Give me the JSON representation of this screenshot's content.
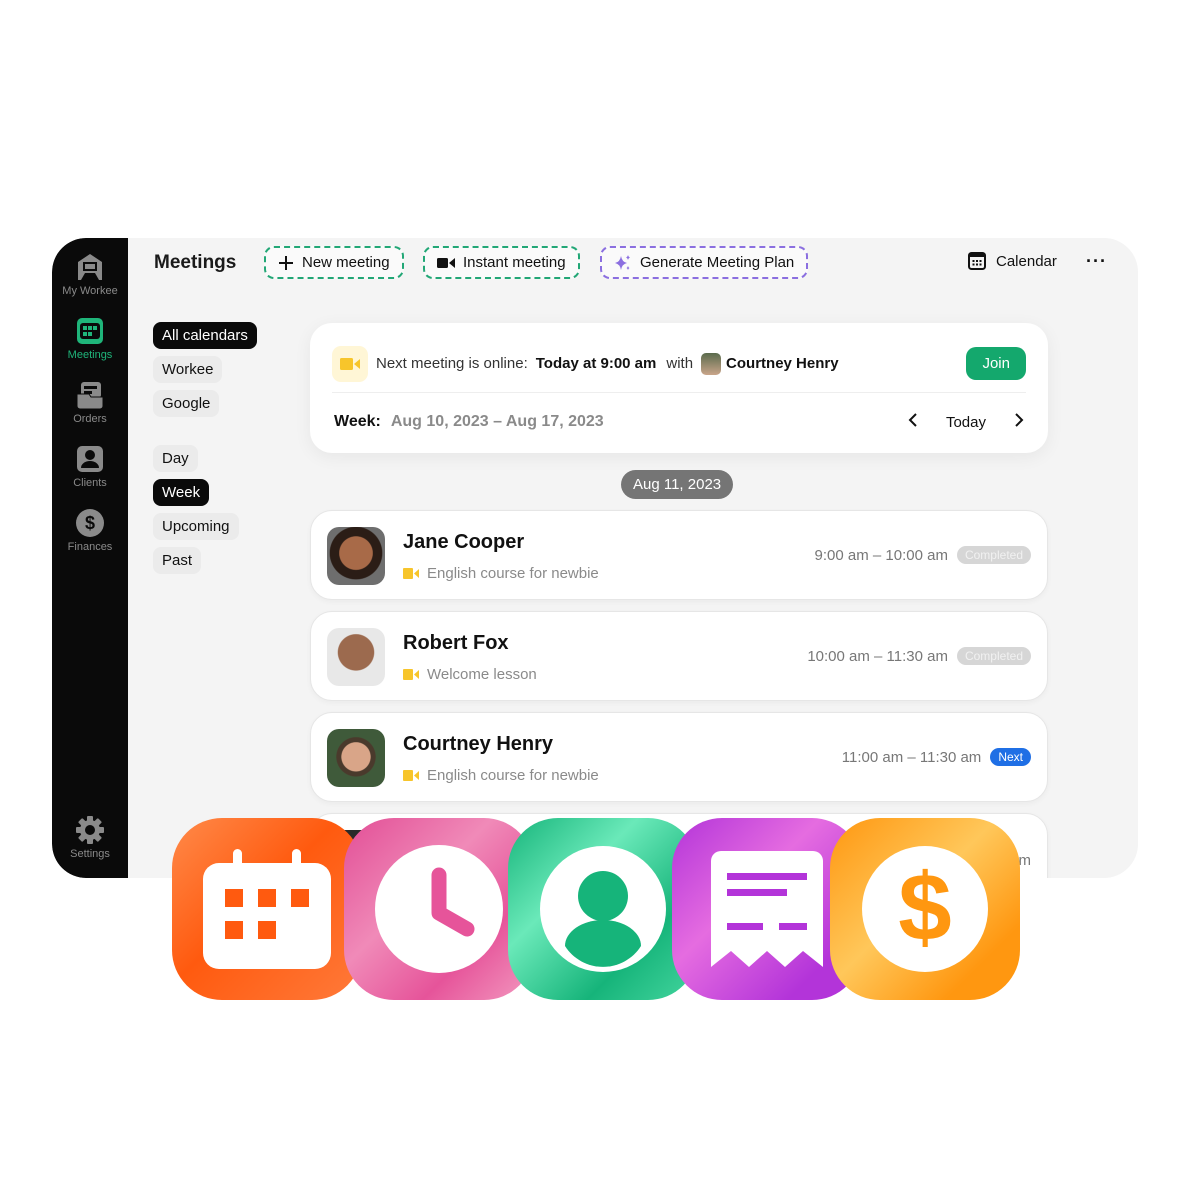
{
  "sidebar": {
    "items": [
      {
        "label": "My Workee",
        "icon": "workee-logo-icon"
      },
      {
        "label": "Meetings",
        "icon": "calendar-grid-icon",
        "active": true
      },
      {
        "label": "Orders",
        "icon": "orders-icon"
      },
      {
        "label": "Clients",
        "icon": "client-icon"
      },
      {
        "label": "Finances",
        "icon": "dollar-icon"
      },
      {
        "label": "Settings",
        "icon": "gear-icon"
      }
    ],
    "active_color": "#1fb57a"
  },
  "toolbar": {
    "title": "Meetings",
    "new_meeting_label": "New meeting",
    "instant_meeting_label": "Instant meeting",
    "generate_plan_label": "Generate Meeting Plan",
    "calendar_label": "Calendar",
    "more_label": "···"
  },
  "filters": {
    "calendars": [
      {
        "label": "All calendars",
        "active": true
      },
      {
        "label": "Workee",
        "active": false
      },
      {
        "label": "Google",
        "active": false
      }
    ],
    "views": [
      {
        "label": "Day",
        "active": false
      },
      {
        "label": "Week",
        "active": true
      },
      {
        "label": "Upcoming",
        "active": false
      },
      {
        "label": "Past",
        "active": false
      }
    ]
  },
  "next_meeting": {
    "prefix": "Next meeting is online:",
    "when": "Today at 9:00 am",
    "with_label": "with",
    "person": "Courtney Henry",
    "join_label": "Join"
  },
  "week": {
    "label": "Week:",
    "range": "Aug 10, 2023 – Aug 17, 2023",
    "today_label": "Today"
  },
  "date_header": "Aug 11, 2023",
  "meetings": [
    {
      "name": "Jane Cooper",
      "topic": "English course for newbie",
      "time": "9:00 am – 10:00 am",
      "status": "Completed"
    },
    {
      "name": "Robert Fox",
      "topic": "Welcome lesson",
      "time": "10:00 am – 11:30 am",
      "status": "Completed"
    },
    {
      "name": "Courtney Henry",
      "topic": "English course for newbie",
      "time": "11:00 am – 11:30 am",
      "status": "Next"
    },
    {
      "name": "",
      "topic": "",
      "time": "…pm",
      "status": ""
    }
  ],
  "app_icons": [
    {
      "name": "calendar-app-icon",
      "color": "#ff5a0f"
    },
    {
      "name": "clock-app-icon",
      "color": "#e6549a"
    },
    {
      "name": "client-app-icon",
      "color": "#16b47a"
    },
    {
      "name": "receipt-app-icon",
      "color": "#b334d9"
    },
    {
      "name": "dollar-app-icon",
      "color": "#ff9710"
    }
  ]
}
